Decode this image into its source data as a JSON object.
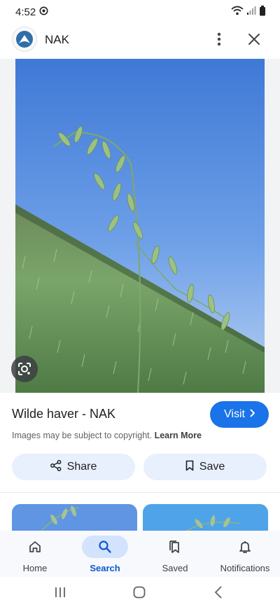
{
  "status_bar": {
    "time": "4:52",
    "left_icons": [
      "sync-circle-icon"
    ],
    "right_icons": [
      "wifi-icon",
      "signal-icon",
      "battery-icon"
    ]
  },
  "header": {
    "site_name": "NAK",
    "logo_icon": "nak-logo-icon",
    "more_icon": "more-vert-icon",
    "close_icon": "close-icon"
  },
  "image": {
    "subject": "wild oat stalk in green wheat field under blue sky",
    "lens_icon": "google-lens-icon"
  },
  "result": {
    "title": "Wilde haver - NAK",
    "visit_label": "Visit",
    "copyright_text": "Images may be subject to copyright.",
    "learn_more_label": "Learn More"
  },
  "actions": {
    "share_label": "Share",
    "save_label": "Save"
  },
  "bottom_nav": {
    "items": [
      {
        "label": "Home",
        "icon": "home-icon",
        "active": false
      },
      {
        "label": "Search",
        "icon": "search-icon",
        "active": true
      },
      {
        "label": "Saved",
        "icon": "saved-collection-icon",
        "active": false
      },
      {
        "label": "Notifications",
        "icon": "bell-icon",
        "active": false
      }
    ]
  },
  "colors": {
    "accent": "#1a73e8",
    "chip_bg": "#e8f0fe",
    "nav_active_bg": "#d3e3fd",
    "nav_active_text": "#0b57d0",
    "sky": "#5b8fe0",
    "field": "#6f9a5e"
  }
}
